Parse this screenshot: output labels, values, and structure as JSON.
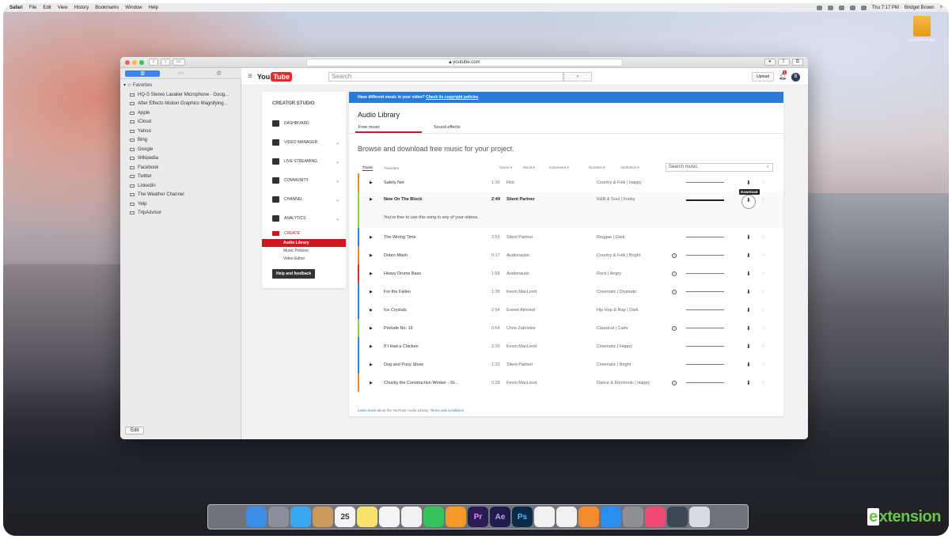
{
  "menubar": {
    "items": [
      "Safari",
      "File",
      "Edit",
      "View",
      "History",
      "Bookmarks",
      "Window",
      "Help"
    ],
    "clock": "Thu 7:17 PM",
    "user": "Bridget Brown"
  },
  "desktop_icon": {
    "label": "Document Folder"
  },
  "browser": {
    "url": "youtube.com",
    "sidebar": {
      "heading": "Favorites",
      "items": [
        "HQ-S Stereo Lavalier Microphone - Goog...",
        "After Effects Motion Graphics Magnifying...",
        "Apple",
        "iCloud",
        "Yahoo",
        "Bing",
        "Google",
        "Wikipedia",
        "Facebook",
        "Twitter",
        "LinkedIn",
        "The Weather Channel",
        "Yelp",
        "TripAdvisor"
      ],
      "edit_label": "Edit"
    }
  },
  "youtube": {
    "logo_you": "You",
    "logo_tube": "Tube",
    "search_placeholder": "Search",
    "upload_label": "Upload",
    "notif_count": "1",
    "avatar_letter": "B"
  },
  "creator_studio": {
    "title": "CREATOR STUDIO",
    "nav": [
      "DASHBOARD",
      "VIDEO MANAGER",
      "LIVE STREAMING",
      "COMMUNITY",
      "CHANNEL",
      "ANALYTICS"
    ],
    "create_label": "CREATE",
    "sub": [
      "Audio Library",
      "Music Policies",
      "Video Editor"
    ],
    "help_label": "Help and feedback"
  },
  "audio_library": {
    "banner_text": "Have different music in your video? ",
    "banner_link": "Check its copyright policies",
    "title": "Audio Library",
    "tabs": [
      "Free music",
      "Sound effects"
    ],
    "browse_text": "Browse and download free music for your project.",
    "filter_tabs": [
      "Tracks",
      "Favorites"
    ],
    "filters": [
      "Genre ▾",
      "Mood ▾",
      "Instrument ▾",
      "Duration ▾",
      "Attribution ▾"
    ],
    "search_placeholder": "Search music",
    "tooltip": "Download",
    "expanded_note": "You're free to use this song in any of your videos.",
    "footer_prefix": "Learn more",
    "footer_mid": " about the YouTube Audio Library. ",
    "footer_link": "Terms and conditions",
    "tracks": [
      {
        "title": "Safety Net",
        "duration": "1:30",
        "artist": "Riot",
        "genre": "Country & Folk | Happy",
        "color": "#e48a2e"
      },
      {
        "title": "New On The Block",
        "duration": "2:49",
        "artist": "Silent Partner",
        "genre": "R&B & Soul | Funky",
        "color": "#8ccf4f"
      },
      {
        "title": "The Wrong Time",
        "duration": "2:53",
        "artist": "Silent Partner",
        "genre": "Reggae | Dark",
        "color": "#3b7dd8"
      },
      {
        "title": "Dobro Mash",
        "duration": "0:17",
        "artist": "Audionautix",
        "genre": "Country & Folk | Bright",
        "color": "#e48a2e"
      },
      {
        "title": "Heavy Drums Bass",
        "duration": "1:58",
        "artist": "Audionautix",
        "genre": "Rock | Angry",
        "color": "#d62d2d"
      },
      {
        "title": "For the Fallen",
        "duration": "1:35",
        "artist": "Kevin MacLeod",
        "genre": "Cinematic | Dramatic",
        "color": "#3b7dd8"
      },
      {
        "title": "Ice Crystals",
        "duration": "2:54",
        "artist": "Everet Almond",
        "genre": "Hip Hop & Rap | Dark",
        "color": "#3b7dd8"
      },
      {
        "title": "Prelude No. 19",
        "duration": "0:54",
        "artist": "Chris Zabriskie",
        "genre": "Classical | Calm",
        "color": "#8ccf4f"
      },
      {
        "title": "If I Had a Chicken",
        "duration": "2:30",
        "artist": "Kevin MacLeod",
        "genre": "Cinematic | Happy",
        "color": "#3b7dd8"
      },
      {
        "title": "Dog and Pony Show",
        "duration": "1:33",
        "artist": "Silent Partner",
        "genre": "Cinematic | Bright",
        "color": "#3b7dd8"
      },
      {
        "title": "Chucky the Construction Worker - St...",
        "duration": "0:28",
        "artist": "Kevin MacLeod",
        "genre": "Dance & Electronic | Happy",
        "color": "#e48a2e"
      }
    ]
  },
  "dock": {
    "apps": [
      "finder-icon",
      "launchpad-icon",
      "safari-icon",
      "contacts-icon",
      "calendar-icon",
      "notes-icon",
      "reminders-icon",
      "photos-icon",
      "facetime-icon",
      "pages-icon",
      "premiere-icon",
      "after-effects-icon",
      "photoshop-icon",
      "numbers-icon",
      "keynote-icon",
      "ibooks-icon",
      "app-store-icon",
      "system-preferences-icon",
      "itunes-icon",
      "quicktime-icon",
      "trash-icon"
    ],
    "calendar_day": "25",
    "pr": "Pr",
    "ae": "Ae",
    "ps": "Ps"
  },
  "watermark": {
    "text": "extension",
    "first_letter": "e"
  }
}
